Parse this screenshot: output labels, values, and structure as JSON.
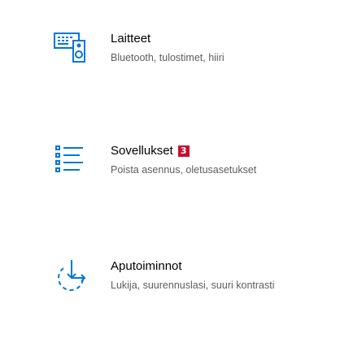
{
  "accent_color": "#0078d7",
  "tiles": [
    {
      "icon": "devices-icon",
      "title": "Laitteet",
      "description": "Bluetooth, tulostimet, hiiri"
    },
    {
      "icon": "apps-list-icon",
      "title": "Sovellukset",
      "badge": "3",
      "description": "Poista asennus, oletusasetukset"
    },
    {
      "icon": "ease-of-access-icon",
      "title": "Aputoiminnot",
      "description": "Lukija, suurennuslasi, suuri kontrasti"
    }
  ]
}
